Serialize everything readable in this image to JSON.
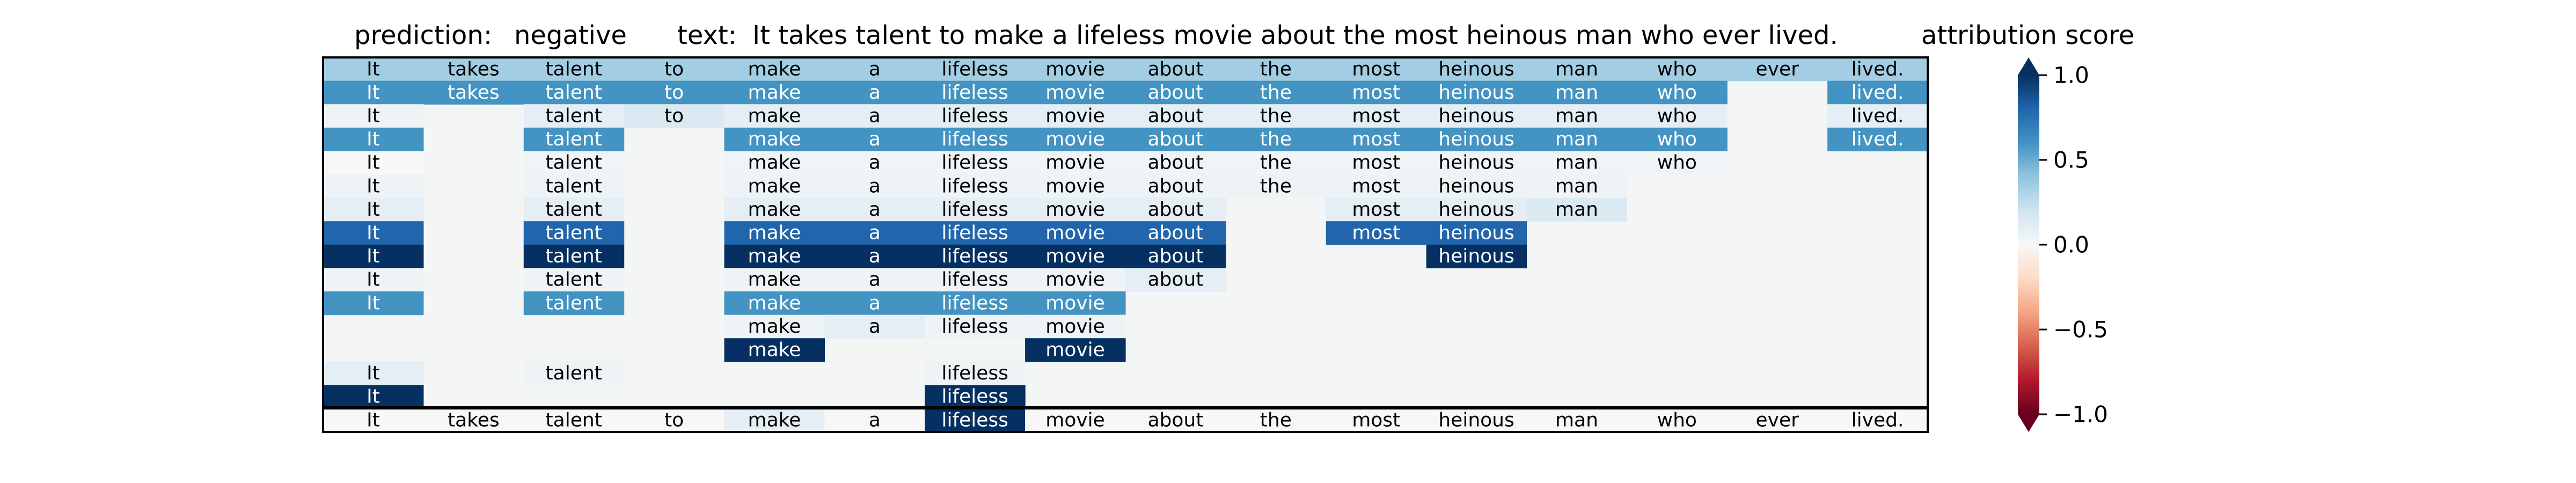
{
  "header": {
    "prediction_label": "prediction:",
    "prediction_value": "negative",
    "text_label": "text:",
    "text_value": "It takes talent to make a lifeless movie about the most heinous man who ever lived.",
    "colorbar_title": "attribution score"
  },
  "chart_data": {
    "type": "heatmap",
    "tokens": [
      "It",
      "takes",
      "talent",
      "to",
      "make",
      "a",
      "lifeless",
      "movie",
      "about",
      "the",
      "most",
      "heinous",
      "man",
      "who",
      "ever",
      "lived."
    ],
    "rows": [
      [
        0.35,
        0.35,
        0.35,
        0.35,
        0.35,
        0.35,
        0.35,
        0.35,
        0.35,
        0.35,
        0.35,
        0.35,
        0.35,
        0.35,
        0.35,
        0.35
      ],
      [
        0.6,
        0.6,
        0.6,
        0.6,
        0.6,
        0.6,
        0.6,
        0.6,
        0.6,
        0.6,
        0.6,
        0.6,
        0.6,
        0.6,
        null,
        0.6
      ],
      [
        0.05,
        null,
        0.1,
        0.15,
        0.1,
        0.1,
        0.1,
        0.1,
        0.1,
        0.1,
        0.1,
        0.1,
        0.1,
        0.1,
        null,
        0.1
      ],
      [
        0.6,
        null,
        0.6,
        null,
        0.6,
        0.6,
        0.6,
        0.6,
        0.6,
        0.6,
        0.6,
        0.6,
        0.6,
        0.6,
        null,
        0.6
      ],
      [
        0.0,
        null,
        0.03,
        null,
        0.03,
        0.03,
        0.03,
        0.03,
        0.03,
        0.03,
        0.03,
        0.03,
        0.03,
        0.03,
        null,
        null
      ],
      [
        0.05,
        null,
        0.05,
        null,
        0.05,
        0.05,
        0.05,
        0.05,
        0.05,
        0.05,
        0.05,
        0.05,
        0.05,
        null,
        null,
        null
      ],
      [
        0.1,
        null,
        0.1,
        null,
        0.1,
        0.1,
        0.1,
        0.1,
        0.1,
        null,
        0.1,
        0.1,
        0.15,
        null,
        null,
        null
      ],
      [
        0.8,
        null,
        0.8,
        null,
        0.8,
        0.8,
        0.8,
        0.8,
        0.8,
        null,
        0.8,
        0.8,
        null,
        null,
        null,
        null
      ],
      [
        1.0,
        null,
        1.0,
        null,
        1.0,
        1.0,
        1.0,
        1.0,
        1.0,
        null,
        null,
        1.0,
        null,
        null,
        null,
        null
      ],
      [
        0.05,
        null,
        0.05,
        null,
        0.05,
        0.05,
        0.05,
        0.05,
        0.1,
        null,
        null,
        null,
        null,
        null,
        null,
        null
      ],
      [
        0.6,
        null,
        0.6,
        null,
        0.6,
        0.6,
        0.6,
        0.6,
        null,
        null,
        null,
        null,
        null,
        null,
        null,
        null
      ],
      [
        null,
        null,
        null,
        null,
        0.05,
        0.1,
        0.05,
        0.05,
        null,
        null,
        null,
        null,
        null,
        null,
        null,
        null
      ],
      [
        null,
        null,
        null,
        null,
        1.0,
        null,
        null,
        1.0,
        null,
        null,
        null,
        null,
        null,
        null,
        null,
        null
      ],
      [
        0.1,
        null,
        0.05,
        null,
        null,
        null,
        0.05,
        null,
        null,
        null,
        null,
        null,
        null,
        null,
        null,
        null
      ],
      [
        1.0,
        null,
        null,
        null,
        null,
        null,
        1.0,
        null,
        null,
        null,
        null,
        null,
        null,
        null,
        null,
        null
      ]
    ],
    "summary_row": [
      0.0,
      0.0,
      0.0,
      0.0,
      0.1,
      0.0,
      1.0,
      0.0,
      0.0,
      0.0,
      0.0,
      0.0,
      0.0,
      0.0,
      0.0,
      0.0
    ],
    "colorbar": {
      "min": -1.0,
      "max": 1.0,
      "ticks": [
        1.0,
        0.5,
        0.0,
        -0.5,
        -1.0
      ],
      "tick_labels": [
        "1.0",
        "0.5",
        "0.0",
        "−0.5",
        "−1.0"
      ],
      "colormap": "RdBu"
    },
    "empty_cell_color": "#f4f6f6"
  }
}
